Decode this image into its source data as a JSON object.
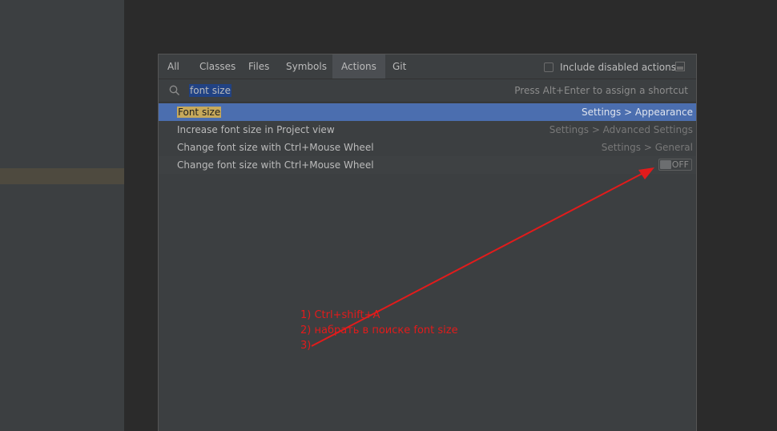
{
  "tabs": [
    {
      "label": "All"
    },
    {
      "label": "Classes"
    },
    {
      "label": "Files"
    },
    {
      "label": "Symbols"
    },
    {
      "label": "Actions"
    },
    {
      "label": "Git"
    }
  ],
  "active_tab": "Actions",
  "include_disabled": {
    "label": "Include disabled actions",
    "checked": false
  },
  "search": {
    "value": "font size",
    "hint": "Press Alt+Enter to assign a shortcut"
  },
  "results": [
    {
      "name": "Font size",
      "location": "Settings > Appearance"
    },
    {
      "name": "Increase font size in Project view",
      "location": "Settings > Advanced Settings"
    },
    {
      "name": "Change font size with Ctrl+Mouse Wheel",
      "location": "Settings > General"
    },
    {
      "name": "Change font size with Ctrl+Mouse Wheel",
      "toggle": "OFF"
    }
  ],
  "annotations": {
    "line1": "1) Ctrl+shift+A",
    "line2": "2) набрать в поиске font size",
    "line3": "3)"
  },
  "colors": {
    "accent_selection": "#4b6eaf",
    "match_highlight": "#c7a95b",
    "annotation": "#e21b1b"
  },
  "icons": {
    "search": "search-icon",
    "pin": "pin-icon"
  }
}
